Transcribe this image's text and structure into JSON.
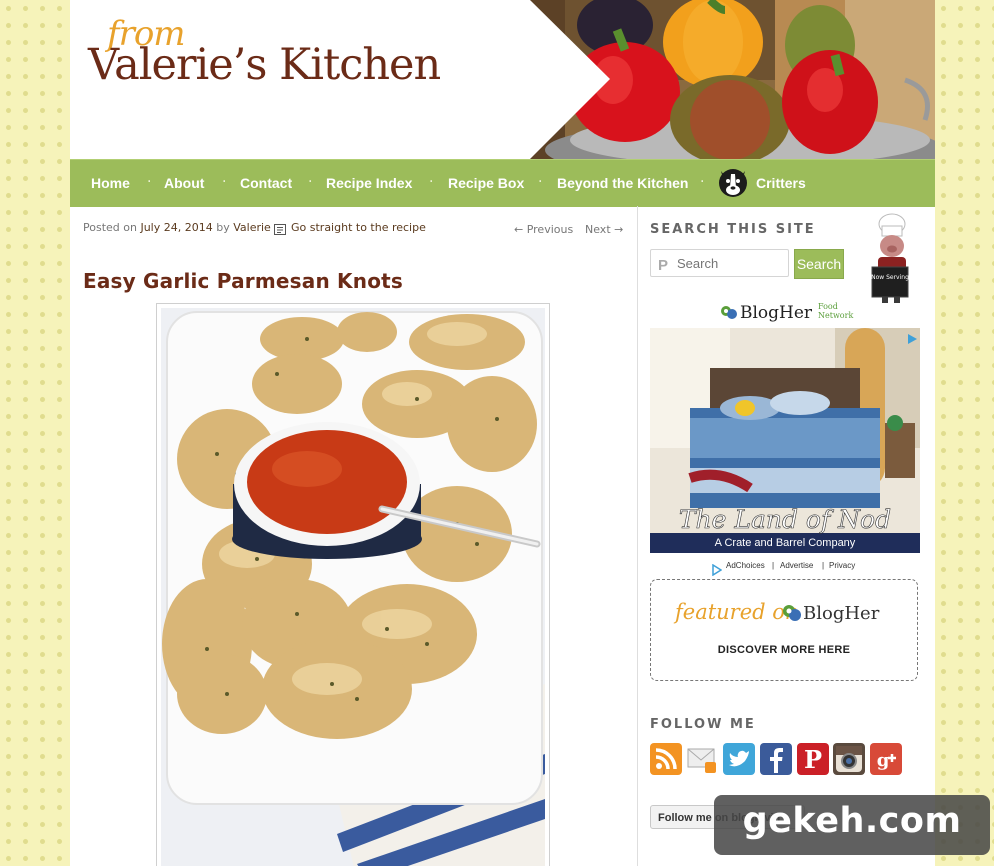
{
  "header": {
    "brand_from": "from",
    "brand_name": "Valerie’s Kitchen"
  },
  "nav": {
    "items": [
      "Home",
      "About",
      "Contact",
      "Recipe Index",
      "Recipe Box",
      "Beyond the Kitchen",
      "Critters"
    ],
    "separator": "·"
  },
  "post": {
    "posted_on_label": "Posted on",
    "date": "July 24, 2014",
    "by_label": "by",
    "author": "Valerie",
    "jump_link": "Go straight to the recipe",
    "prev_label": "← Previous",
    "next_label": "Next →",
    "title": "Easy Garlic Parmesan Knots"
  },
  "sidebar": {
    "search_title": "SEARCH THIS SITE",
    "search_placeholder": "Search",
    "search_button": "Search",
    "blogher_brand": "BlogHer",
    "blogher_sub": "Food Network",
    "ad_title": "The Land of Nod",
    "ad_subtitle": "A Crate and Barrel Company",
    "ad_links": [
      "AdChoices",
      "Advertise",
      "Privacy"
    ],
    "featured_label": "featured on",
    "featured_brand": "BlogHer",
    "featured_cta": "DISCOVER MORE HERE",
    "follow_title": "FOLLOW ME",
    "social_icons": [
      "rss-icon",
      "email-icon",
      "twitter-icon",
      "facebook-icon",
      "pinterest-icon",
      "instagram-icon",
      "google-plus-icon"
    ],
    "bloglovin_label": "Follow me on bloglovin'",
    "chef_badge": "Now Serving"
  },
  "watermark": "gekeh.com",
  "colors": {
    "nav_green": "#9cbc5a",
    "title_brown": "#6b2b17",
    "accent_orange": "#e8a22c",
    "background": "#f6f3ba"
  }
}
